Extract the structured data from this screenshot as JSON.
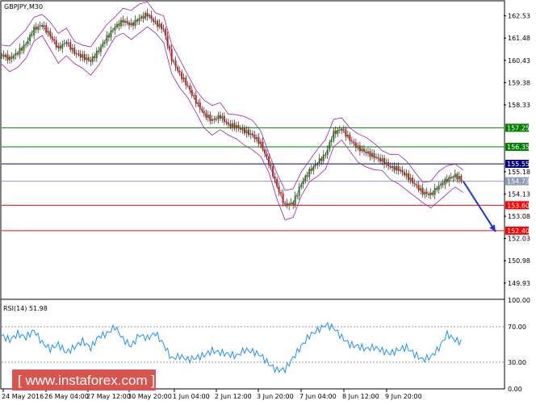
{
  "chart_data": {
    "type": "line",
    "title": "GBPJPY,M30",
    "instrument": "GBPJPY",
    "timeframe": "M30",
    "price_axis": {
      "range": [
        149.2,
        163.2
      ],
      "ticks": [
        "162.53",
        "161.48",
        "160.43",
        "159.38",
        "158.33",
        "157.25",
        "156.35",
        "155.55",
        "155.18",
        "154.73",
        "154.13",
        "153.60",
        "153.08",
        "152.40",
        "152.03",
        "150.98",
        "149.93"
      ]
    },
    "time_axis_labels": [
      "24 May 2016",
      "26 May 04:00",
      "27 May 12:00",
      "30 May 20:00",
      "1 Jun 04:00",
      "2 Jun 12:00",
      "3 Jun 20:00",
      "7 Jun 04:00",
      "8 Jun 12:00",
      "9 Jun 20:00"
    ],
    "levels": [
      {
        "label": "157.25",
        "value": 157.25,
        "color": "#008000"
      },
      {
        "label": "156.35",
        "value": 156.35,
        "color": "#008000"
      },
      {
        "label": "155.55",
        "value": 155.55,
        "color": "#000080"
      },
      {
        "label": "154.73",
        "value": 154.73,
        "color": "#8e9db7"
      },
      {
        "label": "153.60",
        "value": 153.6,
        "color": "#ff0000"
      },
      {
        "label": "152.40",
        "value": 152.4,
        "color": "#ff0000"
      }
    ],
    "price_series": [
      [
        0,
        160.7
      ],
      [
        2,
        160.5
      ],
      [
        4,
        160.8
      ],
      [
        6,
        161.2
      ],
      [
        8,
        161.9
      ],
      [
        10,
        162.1
      ],
      [
        12,
        161.6
      ],
      [
        14,
        161.0
      ],
      [
        16,
        161.3
      ],
      [
        18,
        160.8
      ],
      [
        20,
        160.6
      ],
      [
        22,
        160.4
      ],
      [
        24,
        160.9
      ],
      [
        26,
        161.5
      ],
      [
        28,
        162.0
      ],
      [
        30,
        162.3
      ],
      [
        32,
        162.1
      ],
      [
        34,
        162.4
      ],
      [
        36,
        162.6
      ],
      [
        38,
        162.2
      ],
      [
        40,
        161.9
      ],
      [
        42,
        160.5
      ],
      [
        44,
        159.8
      ],
      [
        46,
        159.2
      ],
      [
        48,
        158.5
      ],
      [
        50,
        157.9
      ],
      [
        52,
        157.6
      ],
      [
        54,
        157.8
      ],
      [
        56,
        157.4
      ],
      [
        58,
        157.3
      ],
      [
        60,
        157.1
      ],
      [
        62,
        156.9
      ],
      [
        64,
        156.5
      ],
      [
        66,
        155.6
      ],
      [
        68,
        154.5
      ],
      [
        70,
        153.6
      ],
      [
        72,
        153.7
      ],
      [
        74,
        154.6
      ],
      [
        76,
        155.2
      ],
      [
        78,
        155.6
      ],
      [
        80,
        156.0
      ],
      [
        82,
        157.0
      ],
      [
        84,
        157.2
      ],
      [
        86,
        156.7
      ],
      [
        88,
        156.3
      ],
      [
        90,
        156.1
      ],
      [
        92,
        155.9
      ],
      [
        94,
        155.7
      ],
      [
        96,
        155.4
      ],
      [
        98,
        155.3
      ],
      [
        100,
        155.0
      ],
      [
        102,
        154.6
      ],
      [
        104,
        154.2
      ],
      [
        106,
        154.1
      ],
      [
        108,
        154.5
      ],
      [
        110,
        154.8
      ],
      [
        112,
        155.0
      ],
      [
        114,
        154.73
      ]
    ],
    "forecast": {
      "from": [
        114,
        154.73
      ],
      "to": [
        122,
        152.35
      ],
      "color": "#1a35d6"
    },
    "bands_color": "#a020a0",
    "rsi": {
      "label": "RSI(14) 51.98",
      "ticks": [
        "100.00",
        "70.00",
        "30.00",
        "0.00"
      ],
      "levels": [
        70,
        30
      ],
      "series": [
        [
          0,
          60
        ],
        [
          2,
          55
        ],
        [
          4,
          62
        ],
        [
          6,
          58
        ],
        [
          8,
          66
        ],
        [
          10,
          52
        ],
        [
          12,
          45
        ],
        [
          14,
          50
        ],
        [
          16,
          41
        ],
        [
          18,
          47
        ],
        [
          20,
          54
        ],
        [
          22,
          46
        ],
        [
          24,
          59
        ],
        [
          26,
          62
        ],
        [
          28,
          70
        ],
        [
          30,
          56
        ],
        [
          32,
          48
        ],
        [
          34,
          61
        ],
        [
          36,
          57
        ],
        [
          38,
          63
        ],
        [
          40,
          50
        ],
        [
          42,
          34
        ],
        [
          44,
          37
        ],
        [
          46,
          33
        ],
        [
          48,
          35
        ],
        [
          50,
          38
        ],
        [
          52,
          43
        ],
        [
          54,
          41
        ],
        [
          56,
          39
        ],
        [
          58,
          37
        ],
        [
          60,
          44
        ],
        [
          62,
          42
        ],
        [
          64,
          38
        ],
        [
          66,
          28
        ],
        [
          68,
          21
        ],
        [
          70,
          22
        ],
        [
          72,
          35
        ],
        [
          74,
          48
        ],
        [
          76,
          60
        ],
        [
          78,
          66
        ],
        [
          80,
          72
        ],
        [
          82,
          69
        ],
        [
          84,
          58
        ],
        [
          86,
          50
        ],
        [
          88,
          48
        ],
        [
          90,
          45
        ],
        [
          92,
          47
        ],
        [
          94,
          43
        ],
        [
          96,
          40
        ],
        [
          98,
          44
        ],
        [
          100,
          47
        ],
        [
          102,
          39
        ],
        [
          104,
          33
        ],
        [
          106,
          36
        ],
        [
          108,
          46
        ],
        [
          110,
          62
        ],
        [
          112,
          55
        ],
        [
          114,
          52
        ]
      ],
      "color": "#1e90ff"
    }
  },
  "watermark": {
    "text": "[ www.instaforex.com ]",
    "color": "#d9534f"
  }
}
